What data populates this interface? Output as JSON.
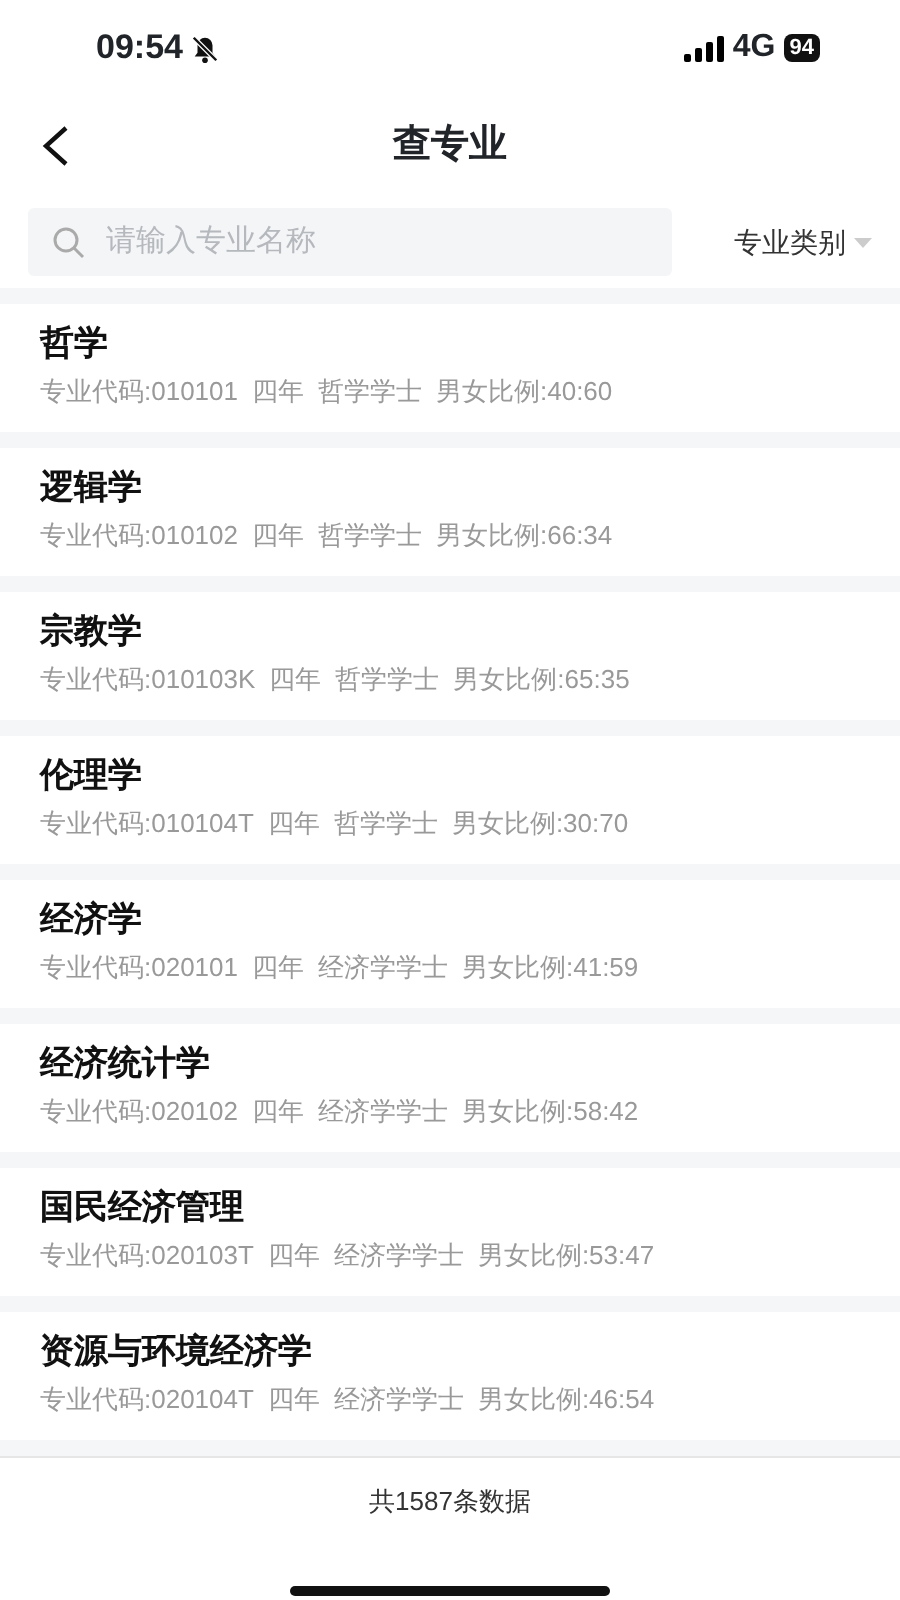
{
  "status_bar": {
    "time": "09:54",
    "network": "4G",
    "battery": "94"
  },
  "header": {
    "title": "查专业"
  },
  "search": {
    "placeholder": "请输入专业名称"
  },
  "filter": {
    "label": "专业类别"
  },
  "majors": [
    {
      "name": "哲学",
      "code": "专业代码:010101",
      "years": "四年",
      "degree": "哲学学士",
      "ratio": "男女比例:40:60"
    },
    {
      "name": "逻辑学",
      "code": "专业代码:010102",
      "years": "四年",
      "degree": "哲学学士",
      "ratio": "男女比例:66:34"
    },
    {
      "name": "宗教学",
      "code": "专业代码:010103K",
      "years": "四年",
      "degree": "哲学学士",
      "ratio": "男女比例:65:35"
    },
    {
      "name": "伦理学",
      "code": "专业代码:010104T",
      "years": "四年",
      "degree": "哲学学士",
      "ratio": "男女比例:30:70"
    },
    {
      "name": "经济学",
      "code": "专业代码:020101",
      "years": "四年",
      "degree": "经济学学士",
      "ratio": "男女比例:41:59"
    },
    {
      "name": "经济统计学",
      "code": "专业代码:020102",
      "years": "四年",
      "degree": "经济学学士",
      "ratio": "男女比例:58:42"
    },
    {
      "name": "国民经济管理",
      "code": "专业代码:020103T",
      "years": "四年",
      "degree": "经济学学士",
      "ratio": "男女比例:53:47"
    },
    {
      "name": "资源与环境经济学",
      "code": "专业代码:020104T",
      "years": "四年",
      "degree": "经济学学士",
      "ratio": "男女比例:46:54"
    }
  ],
  "footer": {
    "count": "共1587条数据"
  }
}
